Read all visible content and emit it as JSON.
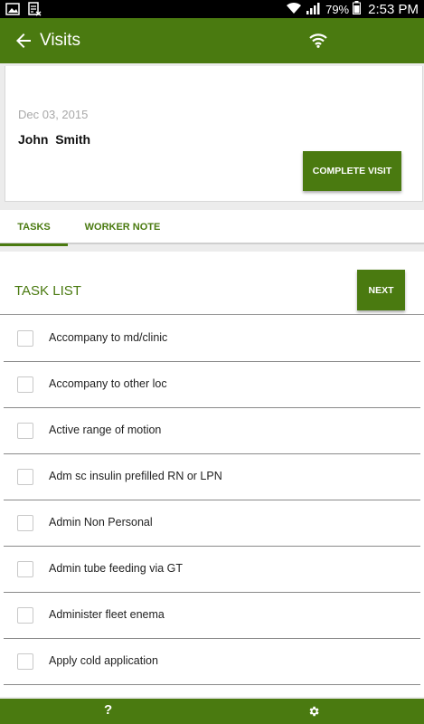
{
  "status_bar": {
    "battery_percent": "79%",
    "time": "2:53 PM",
    "icons": [
      "image-icon",
      "keyboard-icon",
      "wifi-icon",
      "signal-icon",
      "battery-icon"
    ]
  },
  "app_bar": {
    "title": "Visits",
    "back_icon": "arrow-left-icon",
    "center_icon": "wifi-icon"
  },
  "visit": {
    "date": "Dec 03, 2015",
    "client_name": "John  Smith",
    "complete_label": "COMPLETE VISIT"
  },
  "tabs": [
    {
      "label": "TASKS",
      "active": true
    },
    {
      "label": "WORKER NOTE",
      "active": false
    }
  ],
  "task_section": {
    "title": "TASK LIST",
    "next_label": "NEXT",
    "tasks": [
      {
        "label": "Accompany to md/clinic",
        "checked": false
      },
      {
        "label": "Accompany to other loc",
        "checked": false
      },
      {
        "label": "Active range of motion",
        "checked": false
      },
      {
        "label": "Adm sc insulin prefilled RN or LPN",
        "checked": false
      },
      {
        "label": "Admin Non Personal",
        "checked": false
      },
      {
        "label": "Admin tube feeding via GT",
        "checked": false
      },
      {
        "label": "Administer fleet enema",
        "checked": false
      },
      {
        "label": "Apply cold application",
        "checked": false
      }
    ]
  },
  "bottom_bar": {
    "help_label": "?",
    "settings_icon": "gear-icon"
  },
  "colors": {
    "primary": "#4a7a10",
    "background": "#ececec",
    "status_bar": "#000000"
  }
}
